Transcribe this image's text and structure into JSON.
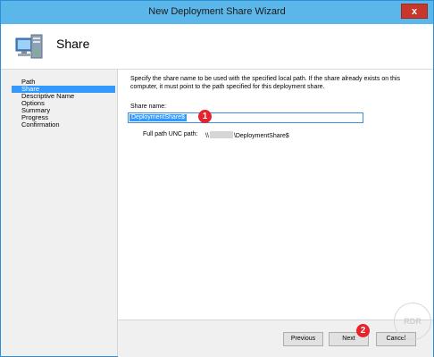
{
  "window": {
    "title": "New Deployment Share Wizard",
    "close_label": "x"
  },
  "header": {
    "title": "Share",
    "icon": "computer-icon"
  },
  "sidebar": {
    "items": [
      {
        "label": "Path",
        "active": false
      },
      {
        "label": "Share",
        "active": true
      },
      {
        "label": "Descriptive Name",
        "active": false
      },
      {
        "label": "Options",
        "active": false
      },
      {
        "label": "Summary",
        "active": false
      },
      {
        "label": "Progress",
        "active": false
      },
      {
        "label": "Confirmation",
        "active": false
      }
    ]
  },
  "main": {
    "description": "Specify the share name to be used with the specified local path.  If the share already exists on this computer, it must point to the path specified for this deployment share.",
    "share_label": "Share name:",
    "share_value": "DeploymentShare$",
    "unc_label": "Full path UNC path:",
    "unc_prefix": "\\\\",
    "unc_suffix": "\\DeploymentShare$"
  },
  "annotations": {
    "badge1": "1",
    "badge2": "2"
  },
  "buttons": {
    "previous": "Previous",
    "next": "Next",
    "cancel": "Cancel"
  },
  "watermark": "RDR",
  "colors": {
    "titlebar": "#5bb7ea",
    "selection": "#3399ff",
    "badge": "#e8222a",
    "close": "#c7372b"
  }
}
